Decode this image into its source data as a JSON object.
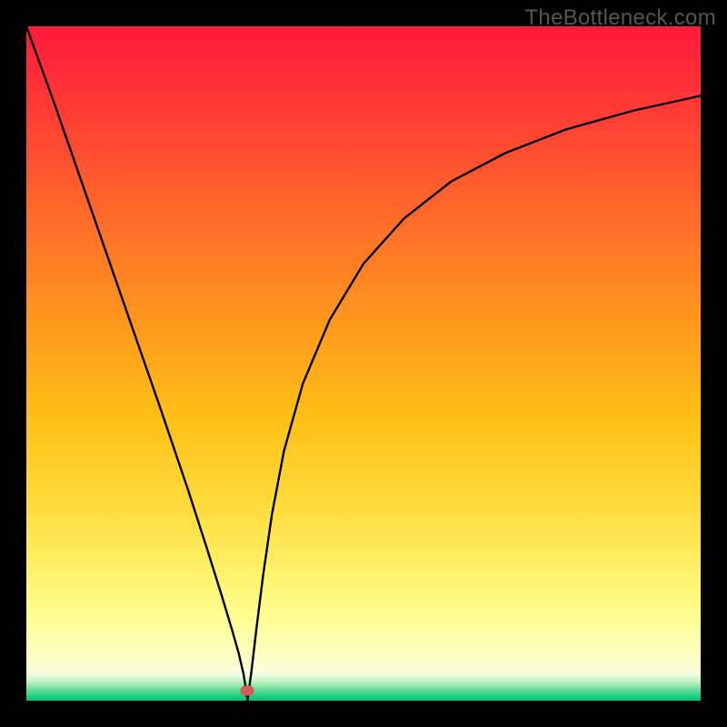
{
  "watermark": "TheBottleneck.com",
  "marker": {
    "x_frac": 0.328,
    "y_frac": 0.985
  },
  "chart_data": {
    "type": "line",
    "title": "",
    "xlabel": "",
    "ylabel": "",
    "xlim": [
      0,
      1
    ],
    "ylim": [
      0,
      1
    ],
    "annotations": [
      "TheBottleneck.com"
    ],
    "background": {
      "type": "vertical-gradient-with-band",
      "stops": [
        {
          "pos": 0.0,
          "color": "#ff1a3a"
        },
        {
          "pos": 0.5,
          "color": "#ffb400"
        },
        {
          "pos": 0.78,
          "color": "#ffe550"
        },
        {
          "pos": 0.88,
          "color": "#ffff99"
        },
        {
          "pos": 0.955,
          "color": "#fafed2"
        },
        {
          "pos": 0.975,
          "color": "#c4f2c4"
        },
        {
          "pos": 0.99,
          "color": "#4fd88f"
        },
        {
          "pos": 1.0,
          "color": "#00c873"
        }
      ]
    },
    "series": [
      {
        "name": "bottleneck-curve",
        "x": [
          0.0,
          0.04,
          0.08,
          0.12,
          0.16,
          0.2,
          0.24,
          0.268,
          0.29,
          0.305,
          0.315,
          0.322,
          0.326,
          0.328,
          0.33,
          0.334,
          0.341,
          0.351,
          0.364,
          0.382,
          0.41,
          0.45,
          0.5,
          0.56,
          0.63,
          0.71,
          0.8,
          0.9,
          1.0
        ],
        "y": [
          1.0,
          0.89,
          0.775,
          0.66,
          0.545,
          0.43,
          0.312,
          0.225,
          0.155,
          0.105,
          0.07,
          0.04,
          0.015,
          0.0,
          0.015,
          0.045,
          0.105,
          0.185,
          0.275,
          0.37,
          0.47,
          0.565,
          0.648,
          0.715,
          0.77,
          0.812,
          0.847,
          0.875,
          0.897
        ]
      }
    ],
    "marker_points": [
      {
        "x": 0.328,
        "y": 0.0,
        "color": "#d06055"
      }
    ]
  }
}
